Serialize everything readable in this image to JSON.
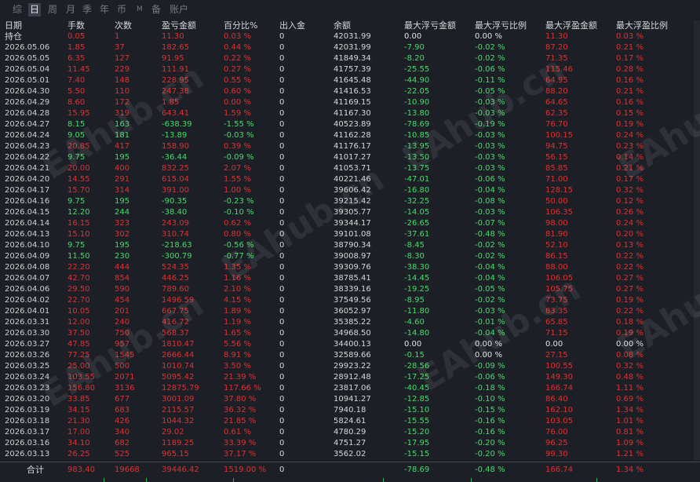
{
  "tabs": [
    "综",
    "日",
    "周",
    "月",
    "季",
    "年",
    "币",
    "M",
    "备",
    "账户"
  ],
  "active_tab": "日",
  "columns": [
    "日期",
    "手数",
    "次数",
    "盈亏金额",
    "百分比%",
    "出入金",
    "余额",
    "最大浮亏金额",
    "最大浮亏比例",
    "最大浮盈金额",
    "最大浮盈比例"
  ],
  "rows": [
    {
      "date": "持仓",
      "lots": "0.05",
      "count": "1",
      "pnl": "11.30",
      "pct": "0.03 %",
      "io": "0",
      "balance": "42031.99",
      "mfl": "0.00",
      "mflp": "0.00 %",
      "mfp": "11.30",
      "mfpp": "0.03 %",
      "color": "red",
      "ddcolor": "white"
    },
    {
      "date": "2026.05.06",
      "lots": "1.85",
      "count": "37",
      "pnl": "182.65",
      "pct": "0.44 %",
      "io": "0",
      "balance": "42031.99",
      "mfl": "-7.90",
      "mflp": "-0.02 %",
      "mfp": "87.20",
      "mfpp": "0.21 %",
      "color": "red",
      "ddcolor": "green"
    },
    {
      "date": "2026.05.05",
      "lots": "6.35",
      "count": "127",
      "pnl": "91.95",
      "pct": "0.22 %",
      "io": "0",
      "balance": "41849.34",
      "mfl": "-8.20",
      "mflp": "-0.02 %",
      "mfp": "71.35",
      "mfpp": "0.17 %",
      "color": "red",
      "ddcolor": "green"
    },
    {
      "date": "2026.05.04",
      "lots": "11.45",
      "count": "229",
      "pnl": "111.91",
      "pct": "0.27 %",
      "io": "0",
      "balance": "41757.39",
      "mfl": "-25.55",
      "mflp": "-0.06 %",
      "mfp": "115.46",
      "mfpp": "0.28 %",
      "color": "red",
      "ddcolor": "green"
    },
    {
      "date": "2026.05.01",
      "lots": "7.40",
      "count": "148",
      "pnl": "228.95",
      "pct": "0.55 %",
      "io": "0",
      "balance": "41645.48",
      "mfl": "-44.90",
      "mflp": "-0.11 %",
      "mfp": "64.95",
      "mfpp": "0.16 %",
      "color": "red",
      "ddcolor": "green"
    },
    {
      "date": "2026.04.30",
      "lots": "5.50",
      "count": "110",
      "pnl": "247.38",
      "pct": "0.60 %",
      "io": "0",
      "balance": "41416.53",
      "mfl": "-22.05",
      "mflp": "-0.05 %",
      "mfp": "88.20",
      "mfpp": "0.21 %",
      "color": "red",
      "ddcolor": "green"
    },
    {
      "date": "2026.04.29",
      "lots": "8.60",
      "count": "172",
      "pnl": "1.85",
      "pct": "0.00 %",
      "io": "0",
      "balance": "41169.15",
      "mfl": "-10.90",
      "mflp": "-0.03 %",
      "mfp": "64.65",
      "mfpp": "0.16 %",
      "color": "red",
      "ddcolor": "green"
    },
    {
      "date": "2026.04.28",
      "lots": "15.95",
      "count": "319",
      "pnl": "643.41",
      "pct": "1.59 %",
      "io": "0",
      "balance": "41167.30",
      "mfl": "-13.80",
      "mflp": "-0.03 %",
      "mfp": "62.35",
      "mfpp": "0.15 %",
      "color": "red",
      "ddcolor": "green"
    },
    {
      "date": "2026.04.27",
      "lots": "8.15",
      "count": "163",
      "pnl": "-638.39",
      "pct": "-1.55 %",
      "io": "0",
      "balance": "40523.89",
      "mfl": "-78.69",
      "mflp": "-0.19 %",
      "mfp": "76.70",
      "mfpp": "0.19 %",
      "color": "green",
      "ddcolor": "green"
    },
    {
      "date": "2026.04.24",
      "lots": "9.05",
      "count": "181",
      "pnl": "-13.89",
      "pct": "-0.03 %",
      "io": "0",
      "balance": "41162.28",
      "mfl": "-10.85",
      "mflp": "-0.03 %",
      "mfp": "100.15",
      "mfpp": "0.24 %",
      "color": "green",
      "ddcolor": "green"
    },
    {
      "date": "2026.04.23",
      "lots": "20.85",
      "count": "417",
      "pnl": "158.90",
      "pct": "0.39 %",
      "io": "0",
      "balance": "41176.17",
      "mfl": "-13.95",
      "mflp": "-0.03 %",
      "mfp": "94.75",
      "mfpp": "0.23 %",
      "color": "red",
      "ddcolor": "green"
    },
    {
      "date": "2026.04.22",
      "lots": "9.75",
      "count": "195",
      "pnl": "-36.44",
      "pct": "-0.09 %",
      "io": "0",
      "balance": "41017.27",
      "mfl": "-13.50",
      "mflp": "-0.03 %",
      "mfp": "56.15",
      "mfpp": "0.14 %",
      "color": "green",
      "ddcolor": "green"
    },
    {
      "date": "2026.04.21",
      "lots": "20.00",
      "count": "400",
      "pnl": "832.25",
      "pct": "2.07 %",
      "io": "0",
      "balance": "41053.71",
      "mfl": "-13.75",
      "mflp": "-0.03 %",
      "mfp": "85.85",
      "mfpp": "0.21 %",
      "color": "red",
      "ddcolor": "green"
    },
    {
      "date": "2026.04.20",
      "lots": "14.55",
      "count": "291",
      "pnl": "615.04",
      "pct": "1.55 %",
      "io": "0",
      "balance": "40221.46",
      "mfl": "-47.01",
      "mflp": "-0.06 %",
      "mfp": "71.00",
      "mfpp": "0.17 %",
      "color": "red",
      "ddcolor": "green"
    },
    {
      "date": "2026.04.17",
      "lots": "15.70",
      "count": "314",
      "pnl": "391.00",
      "pct": "1.00 %",
      "io": "0",
      "balance": "39606.42",
      "mfl": "-16.80",
      "mflp": "-0.04 %",
      "mfp": "128.15",
      "mfpp": "0.32 %",
      "color": "red",
      "ddcolor": "green"
    },
    {
      "date": "2026.04.16",
      "lots": "9.75",
      "count": "195",
      "pnl": "-90.35",
      "pct": "-0.23 %",
      "io": "0",
      "balance": "39215.42",
      "mfl": "-32.25",
      "mflp": "-0.08 %",
      "mfp": "50.00",
      "mfpp": "0.12 %",
      "color": "green",
      "ddcolor": "green"
    },
    {
      "date": "2026.04.15",
      "lots": "12.20",
      "count": "244",
      "pnl": "-38.40",
      "pct": "-0.10 %",
      "io": "0",
      "balance": "39305.77",
      "mfl": "-14.05",
      "mflp": "-0.03 %",
      "mfp": "106.35",
      "mfpp": "0.26 %",
      "color": "green",
      "ddcolor": "green"
    },
    {
      "date": "2026.04.14",
      "lots": "16.15",
      "count": "323",
      "pnl": "243.09",
      "pct": "0.62 %",
      "io": "0",
      "balance": "39344.17",
      "mfl": "-26.65",
      "mflp": "-0.07 %",
      "mfp": "98.00",
      "mfpp": "0.24 %",
      "color": "red",
      "ddcolor": "green"
    },
    {
      "date": "2026.04.13",
      "lots": "15.10",
      "count": "302",
      "pnl": "310.74",
      "pct": "0.80 %",
      "io": "0",
      "balance": "39101.08",
      "mfl": "-37.61",
      "mflp": "-0.48 %",
      "mfp": "81.90",
      "mfpp": "0.20 %",
      "color": "red",
      "ddcolor": "green"
    },
    {
      "date": "2026.04.10",
      "lots": "9.75",
      "count": "195",
      "pnl": "-218.63",
      "pct": "-0.56 %",
      "io": "0",
      "balance": "38790.34",
      "mfl": "-8.45",
      "mflp": "-0.02 %",
      "mfp": "52.10",
      "mfpp": "0.13 %",
      "color": "green",
      "ddcolor": "green"
    },
    {
      "date": "2026.04.09",
      "lots": "11.50",
      "count": "230",
      "pnl": "-300.79",
      "pct": "-0.77 %",
      "io": "0",
      "balance": "39008.97",
      "mfl": "-8.30",
      "mflp": "-0.02 %",
      "mfp": "86.15",
      "mfpp": "0.22 %",
      "color": "green",
      "ddcolor": "green"
    },
    {
      "date": "2026.04.08",
      "lots": "22.20",
      "count": "444",
      "pnl": "524.35",
      "pct": "1.35 %",
      "io": "0",
      "balance": "39309.76",
      "mfl": "-38.30",
      "mflp": "-0.04 %",
      "mfp": "88.00",
      "mfpp": "0.22 %",
      "color": "red",
      "ddcolor": "green"
    },
    {
      "date": "2026.04.07",
      "lots": "42.70",
      "count": "854",
      "pnl": "446.25",
      "pct": "1.16 %",
      "io": "0",
      "balance": "38785.41",
      "mfl": "-14.45",
      "mflp": "-0.04 %",
      "mfp": "106.05",
      "mfpp": "0.27 %",
      "color": "red",
      "ddcolor": "green"
    },
    {
      "date": "2026.04.06",
      "lots": "29.50",
      "count": "590",
      "pnl": "789.60",
      "pct": "2.10 %",
      "io": "0",
      "balance": "38339.16",
      "mfl": "-19.25",
      "mflp": "-0.05 %",
      "mfp": "105.75",
      "mfpp": "0.27 %",
      "color": "red",
      "ddcolor": "green"
    },
    {
      "date": "2026.04.02",
      "lots": "22.70",
      "count": "454",
      "pnl": "1496.59",
      "pct": "4.15 %",
      "io": "0",
      "balance": "37549.56",
      "mfl": "-8.95",
      "mflp": "-0.02 %",
      "mfp": "73.75",
      "mfpp": "0.19 %",
      "color": "red",
      "ddcolor": "green"
    },
    {
      "date": "2026.04.01",
      "lots": "10.05",
      "count": "201",
      "pnl": "667.75",
      "pct": "1.89 %",
      "io": "0",
      "balance": "36052.97",
      "mfl": "-11.80",
      "mflp": "-0.03 %",
      "mfp": "83.35",
      "mfpp": "0.22 %",
      "color": "red",
      "ddcolor": "green"
    },
    {
      "date": "2026.03.31",
      "lots": "12.00",
      "count": "240",
      "pnl": "416.72",
      "pct": "1.19 %",
      "io": "0",
      "balance": "35385.22",
      "mfl": "-4.60",
      "mflp": "-0.01 %",
      "mfp": "65.85",
      "mfpp": "0.18 %",
      "color": "red",
      "ddcolor": "green"
    },
    {
      "date": "2026.03.30",
      "lots": "37.50",
      "count": "750",
      "pnl": "568.37",
      "pct": "1.65 %",
      "io": "0",
      "balance": "34968.50",
      "mfl": "-14.80",
      "mflp": "-0.04 %",
      "mfp": "71.15",
      "mfpp": "0.19 %",
      "color": "red",
      "ddcolor": "green"
    },
    {
      "date": "2026.03.27",
      "lots": "47.85",
      "count": "957",
      "pnl": "1810.47",
      "pct": "5.56 %",
      "io": "0",
      "balance": "34400.13",
      "mfl": "0.00",
      "mflp": "0.00 %",
      "mfp": "0.00",
      "mfpp": "0.00 %",
      "color": "red",
      "ddcolor": "white",
      "mfpwhite": true
    },
    {
      "date": "2026.03.26",
      "lots": "77.25",
      "count": "1545",
      "pnl": "2666.44",
      "pct": "8.91 %",
      "io": "0",
      "balance": "32589.66",
      "mfl": "-0.15",
      "mflp": "0.00 %",
      "mfp": "27.15",
      "mfpp": "0.08 %",
      "color": "red",
      "ddcolor": "green",
      "mflpwhite": true
    },
    {
      "date": "2026.03.25",
      "lots": "25.00",
      "count": "500",
      "pnl": "1010.74",
      "pct": "3.50 %",
      "io": "0",
      "balance": "29923.22",
      "mfl": "-28.56",
      "mflp": "-0.09 %",
      "mfp": "100.55",
      "mfpp": "0.32 %",
      "color": "red",
      "ddcolor": "green"
    },
    {
      "date": "2026.03.24",
      "lots": "103.55",
      "count": "2071",
      "pnl": "5095.42",
      "pct": "21.39 %",
      "io": "0",
      "balance": "28912.48",
      "mfl": "-17.25",
      "mflp": "-0.06 %",
      "mfp": "149.30",
      "mfpp": "0.48 %",
      "color": "red",
      "ddcolor": "green"
    },
    {
      "date": "2026.03.23",
      "lots": "156.80",
      "count": "3136",
      "pnl": "12875.79",
      "pct": "117.66 %",
      "io": "0",
      "balance": "23817.06",
      "mfl": "-40.45",
      "mflp": "-0.18 %",
      "mfp": "166.74",
      "mfpp": "1.11 %",
      "color": "red",
      "ddcolor": "green"
    },
    {
      "date": "2026.03.20",
      "lots": "33.85",
      "count": "677",
      "pnl": "3001.09",
      "pct": "37.80 %",
      "io": "0",
      "balance": "10941.27",
      "mfl": "-12.85",
      "mflp": "-0.10 %",
      "mfp": "86.40",
      "mfpp": "0.69 %",
      "color": "red",
      "ddcolor": "green"
    },
    {
      "date": "2026.03.19",
      "lots": "34.15",
      "count": "683",
      "pnl": "2115.57",
      "pct": "36.32 %",
      "io": "0",
      "balance": "7940.18",
      "mfl": "-15.10",
      "mflp": "-0.15 %",
      "mfp": "162.10",
      "mfpp": "1.34 %",
      "color": "red",
      "ddcolor": "green"
    },
    {
      "date": "2026.03.18",
      "lots": "21.30",
      "count": "426",
      "pnl": "1044.32",
      "pct": "21.85 %",
      "io": "0",
      "balance": "5824.61",
      "mfl": "-15.55",
      "mflp": "-0.16 %",
      "mfp": "103.05",
      "mfpp": "1.01 %",
      "color": "red",
      "ddcolor": "green"
    },
    {
      "date": "2026.03.17",
      "lots": "17.00",
      "count": "340",
      "pnl": "29.02",
      "pct": "0.61 %",
      "io": "0",
      "balance": "4780.29",
      "mfl": "-15.20",
      "mflp": "-0.16 %",
      "mfp": "76.00",
      "mfpp": "0.81 %",
      "color": "red",
      "ddcolor": "green"
    },
    {
      "date": "2026.03.16",
      "lots": "34.10",
      "count": "682",
      "pnl": "1189.25",
      "pct": "33.39 %",
      "io": "0",
      "balance": "4751.27",
      "mfl": "-17.95",
      "mflp": "-0.20 %",
      "mfp": "96.25",
      "mfpp": "1.09 %",
      "color": "red",
      "ddcolor": "green"
    },
    {
      "date": "2026.03.13",
      "lots": "26.25",
      "count": "525",
      "pnl": "965.15",
      "pct": "37.17 %",
      "io": "0",
      "balance": "3562.02",
      "mfl": "-15.15",
      "mflp": "-0.20 %",
      "mfp": "99.30",
      "mfpp": "1.21 %",
      "color": "red",
      "ddcolor": "green"
    }
  ],
  "totals": {
    "label": "合计",
    "lots": "983.40",
    "count": "19668",
    "pnl": "39446.42",
    "pct": "1519.00 %",
    "io": "0",
    "balance": "",
    "mfl": "-78.69",
    "mflp": "-0.48 %",
    "mfp": "166.74",
    "mfpp": "1.34 %"
  },
  "colors": {
    "background": "#1c1f26",
    "profit": "#e23030",
    "loss": "#3ee064",
    "text": "#d8d8d8"
  }
}
